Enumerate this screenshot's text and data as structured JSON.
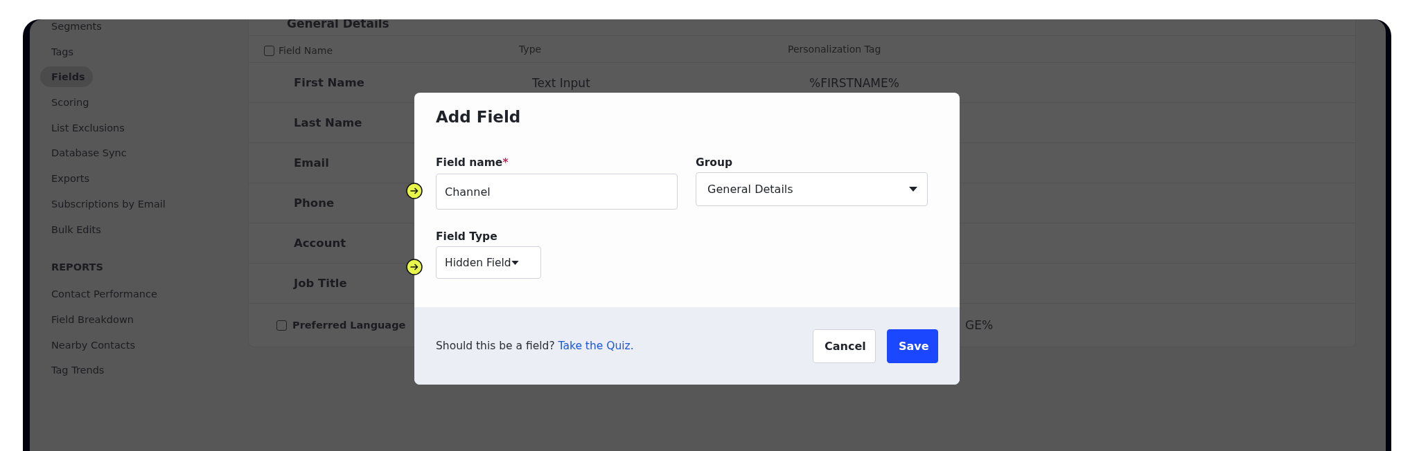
{
  "sidebar": {
    "items": [
      {
        "label": "Segments",
        "selected": false
      },
      {
        "label": "Tags",
        "selected": false
      },
      {
        "label": "Fields",
        "selected": true
      },
      {
        "label": "Scoring",
        "selected": false
      },
      {
        "label": "List Exclusions",
        "selected": false
      },
      {
        "label": "Database Sync",
        "selected": false
      },
      {
        "label": "Exports",
        "selected": false
      },
      {
        "label": "Subscriptions by Email",
        "selected": false
      },
      {
        "label": "Bulk Edits",
        "selected": false
      }
    ],
    "reports_heading": "REPORTS",
    "reports": [
      {
        "label": "Contact Performance",
        "selected": false
      },
      {
        "label": "Field Breakdown",
        "selected": false
      },
      {
        "label": "Nearby Contacts",
        "selected": false
      },
      {
        "label": "Tag Trends",
        "selected": false
      }
    ]
  },
  "table": {
    "group_title": "General Details",
    "columns": [
      "Field Name",
      "Type",
      "Personalization Tag"
    ],
    "header_checked": false,
    "rows": [
      {
        "kind": "plain",
        "name": "First Name",
        "type": "Text Input",
        "tag": "%FIRSTNAME%"
      },
      {
        "kind": "plain",
        "name": "Last Name"
      },
      {
        "kind": "plain",
        "name": "Email"
      },
      {
        "kind": "plain",
        "name": "Phone"
      },
      {
        "kind": "plain",
        "name": "Account"
      },
      {
        "kind": "plain",
        "name": "Job Title"
      },
      {
        "kind": "checkbox",
        "checked": false,
        "name": "Preferred Language",
        "tag": "GE%"
      }
    ]
  },
  "dialog": {
    "title": "Add Field",
    "field_name": {
      "label": "Field name",
      "required_mark": "*",
      "value": "Channel"
    },
    "group": {
      "label": "Group",
      "value": "General Details"
    },
    "field_type": {
      "label": "Field Type",
      "value": "Hidden Field"
    },
    "footer_text": "Should this be a field?",
    "footer_link": "Take the Quiz.",
    "buttons": [
      {
        "kind": "secondary",
        "label": "Cancel"
      },
      {
        "kind": "primary",
        "label": "Save"
      }
    ]
  }
}
